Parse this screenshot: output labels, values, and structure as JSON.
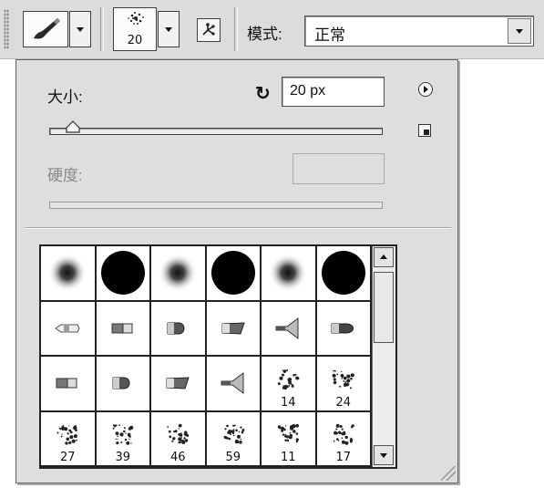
{
  "toolbar": {
    "brush_size_preview": "20",
    "mode_label": "模式:",
    "mode_value": "正常",
    "icons": [
      "brush-tool-icon",
      "brush-preset-icon",
      "airbrush-icon"
    ]
  },
  "picker": {
    "size_label": "大小:",
    "size_value": "20 px",
    "size_slider_fraction": 0.07,
    "hardness_label": "硬度:",
    "hardness_value": "",
    "icons": [
      "reset-icon",
      "panel-menu-icon",
      "new-preset-icon"
    ]
  },
  "brushes": [
    {
      "kind": "soft",
      "label": ""
    },
    {
      "kind": "hard",
      "label": ""
    },
    {
      "kind": "soft",
      "label": ""
    },
    {
      "kind": "hard",
      "label": ""
    },
    {
      "kind": "soft",
      "label": ""
    },
    {
      "kind": "hard",
      "label": ""
    },
    {
      "kind": "marker-tip",
      "label": ""
    },
    {
      "kind": "flat-block",
      "label": ""
    },
    {
      "kind": "round-tip",
      "label": ""
    },
    {
      "kind": "slant-tip",
      "label": ""
    },
    {
      "kind": "fan-tip",
      "label": ""
    },
    {
      "kind": "bullet-tip",
      "label": ""
    },
    {
      "kind": "flat-block",
      "label": ""
    },
    {
      "kind": "round-tip",
      "label": ""
    },
    {
      "kind": "slant-tip",
      "label": ""
    },
    {
      "kind": "fan-tip",
      "label": ""
    },
    {
      "kind": "splatter",
      "label": "14"
    },
    {
      "kind": "splatter",
      "label": "24"
    },
    {
      "kind": "splatter",
      "label": "27"
    },
    {
      "kind": "splatter",
      "label": "39"
    },
    {
      "kind": "splatter",
      "label": "46"
    },
    {
      "kind": "splatter",
      "label": "59"
    },
    {
      "kind": "splatter",
      "label": "11"
    },
    {
      "kind": "splatter",
      "label": "17"
    }
  ]
}
